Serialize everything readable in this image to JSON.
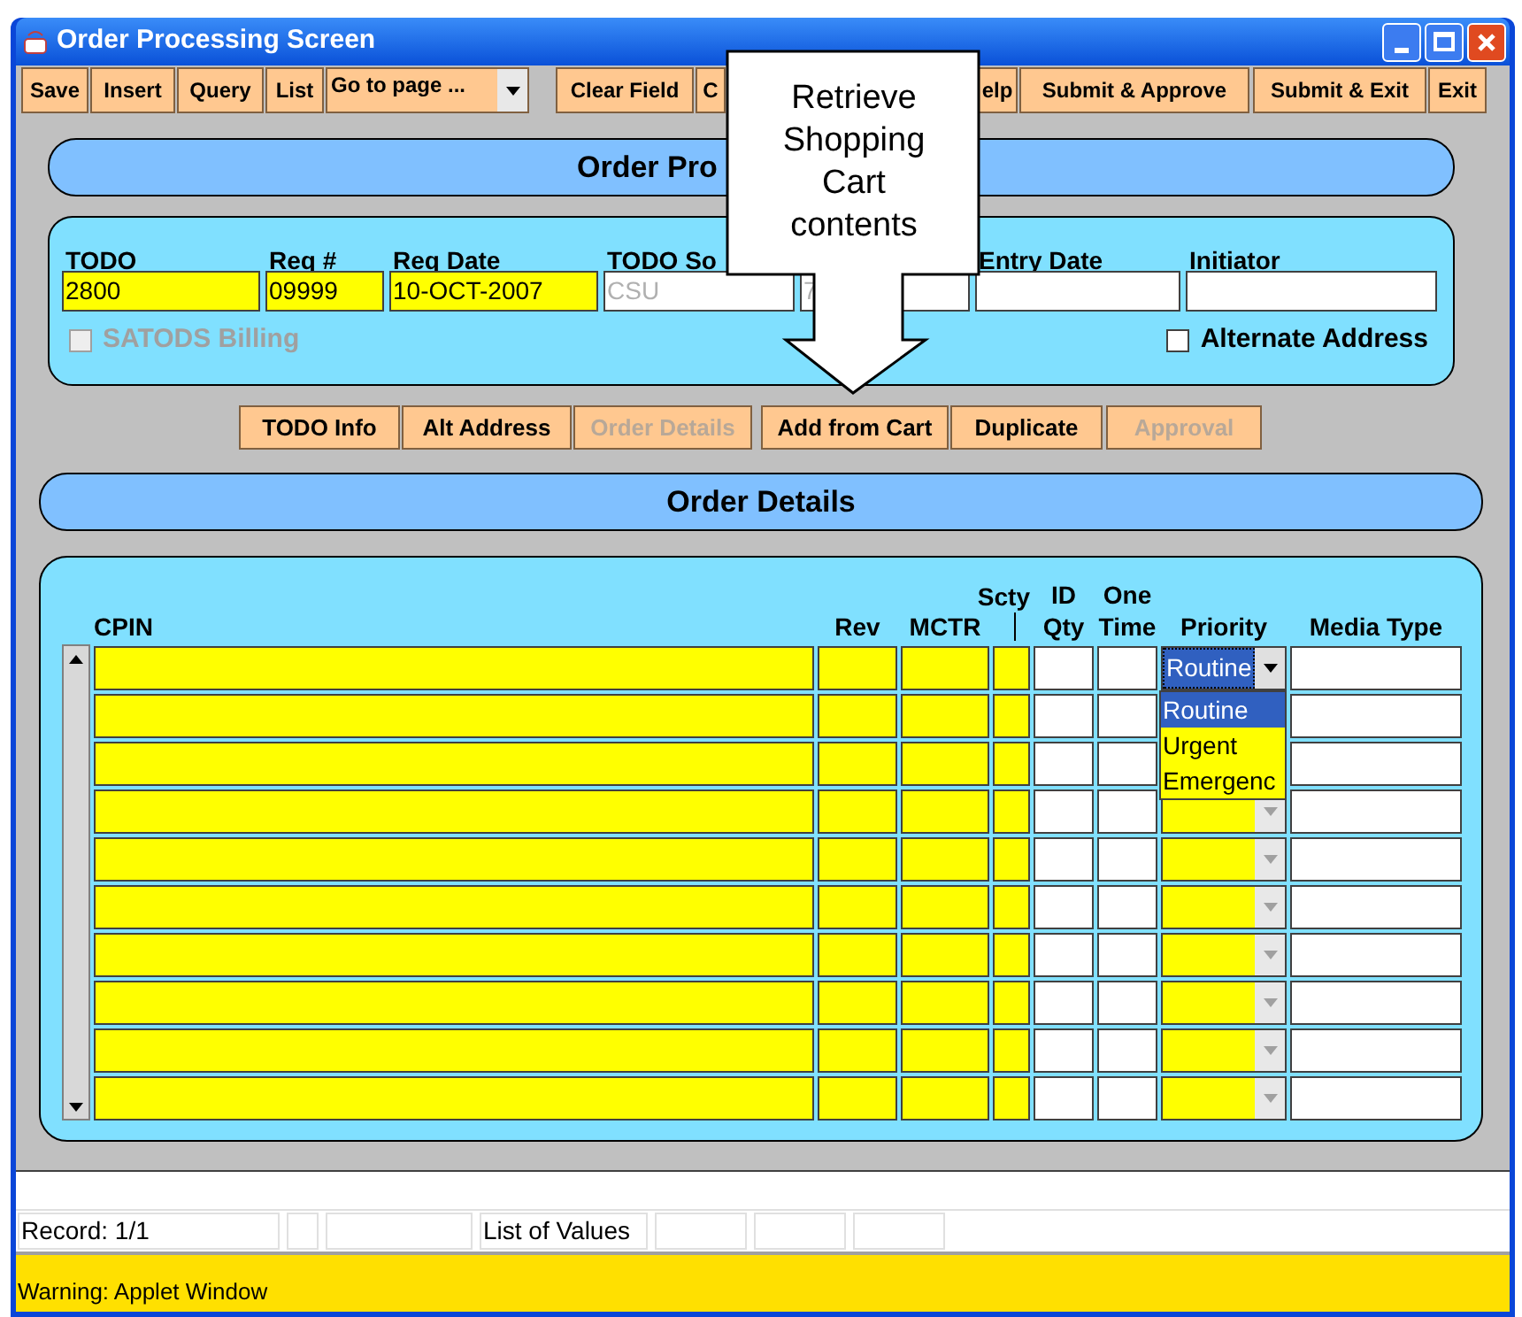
{
  "window": {
    "title": "Order Processing Screen"
  },
  "toolbar": [
    {
      "label": "Save",
      "kind": "button"
    },
    {
      "label": "Insert",
      "kind": "button"
    },
    {
      "label": "Query",
      "kind": "button"
    },
    {
      "label": "List",
      "kind": "button"
    },
    {
      "label": "Go to page ...",
      "kind": "dropdown"
    },
    {
      "label": "Clear Field",
      "kind": "button"
    },
    {
      "label": "C",
      "kind": "button"
    },
    {
      "label": "elp",
      "kind": "button"
    },
    {
      "label": "Submit & Approve",
      "kind": "button"
    },
    {
      "label": "Submit & Exit",
      "kind": "button"
    },
    {
      "label": "Exit",
      "kind": "button"
    }
  ],
  "callout": {
    "text": "Retrieve Shopping Cart contents"
  },
  "header": {
    "title": "Order Pro"
  },
  "todo_fields": [
    {
      "label": "TODO",
      "value": "2800",
      "kind": "required"
    },
    {
      "label": "Req #",
      "value": "09999",
      "kind": "required"
    },
    {
      "label": "Req Date",
      "value": "10-OCT-2007",
      "kind": "required"
    },
    {
      "label": "TODO So",
      "value": "CSU",
      "kind": "disabled"
    },
    {
      "value": "7",
      "kind": "disabled"
    },
    {
      "label": "Entry Date",
      "kind": "normal"
    },
    {
      "label": "Initiator",
      "kind": "normal"
    }
  ],
  "checkboxes": [
    {
      "label": "SATODS Billing",
      "checked": false,
      "disabled": true
    },
    {
      "label": "Alternate Address",
      "checked": false,
      "disabled": false
    }
  ],
  "buttons": [
    {
      "label": "TODO Info",
      "disabled": false
    },
    {
      "label": "Alt Address",
      "disabled": false
    },
    {
      "label": "Order Details",
      "disabled": true
    },
    {
      "label": "Add from Cart",
      "disabled": false
    },
    {
      "label": "Duplicate",
      "disabled": false
    },
    {
      "label": "Approval",
      "disabled": true
    }
  ],
  "details": {
    "title": "Order Details",
    "columns": [
      {
        "lines": [
          "CPIN"
        ]
      },
      {
        "lines": [
          "Rev"
        ]
      },
      {
        "lines": [
          "MCTR"
        ]
      },
      {
        "lines": [
          "Scty"
        ]
      },
      {
        "lines": [
          "ID",
          "Qty"
        ]
      },
      {
        "lines": [
          "One",
          "Time"
        ]
      },
      {
        "lines": [
          "Priority"
        ]
      },
      {
        "lines": [
          "Media Type"
        ]
      }
    ],
    "rows": [
      {
        "priority": "Routine"
      },
      {},
      {},
      {},
      {},
      {},
      {},
      {},
      {},
      {}
    ],
    "priority_dropdown": {
      "options": [
        {
          "label": "Routine",
          "selected": true
        },
        {
          "label": "Urgent",
          "selected": false
        },
        {
          "label": "Emergenc",
          "selected": false
        }
      ]
    }
  },
  "status_bar": {
    "record": "Record: 1/1",
    "list_of_values": "List of Values",
    "warning": "Warning: Applet Window"
  }
}
